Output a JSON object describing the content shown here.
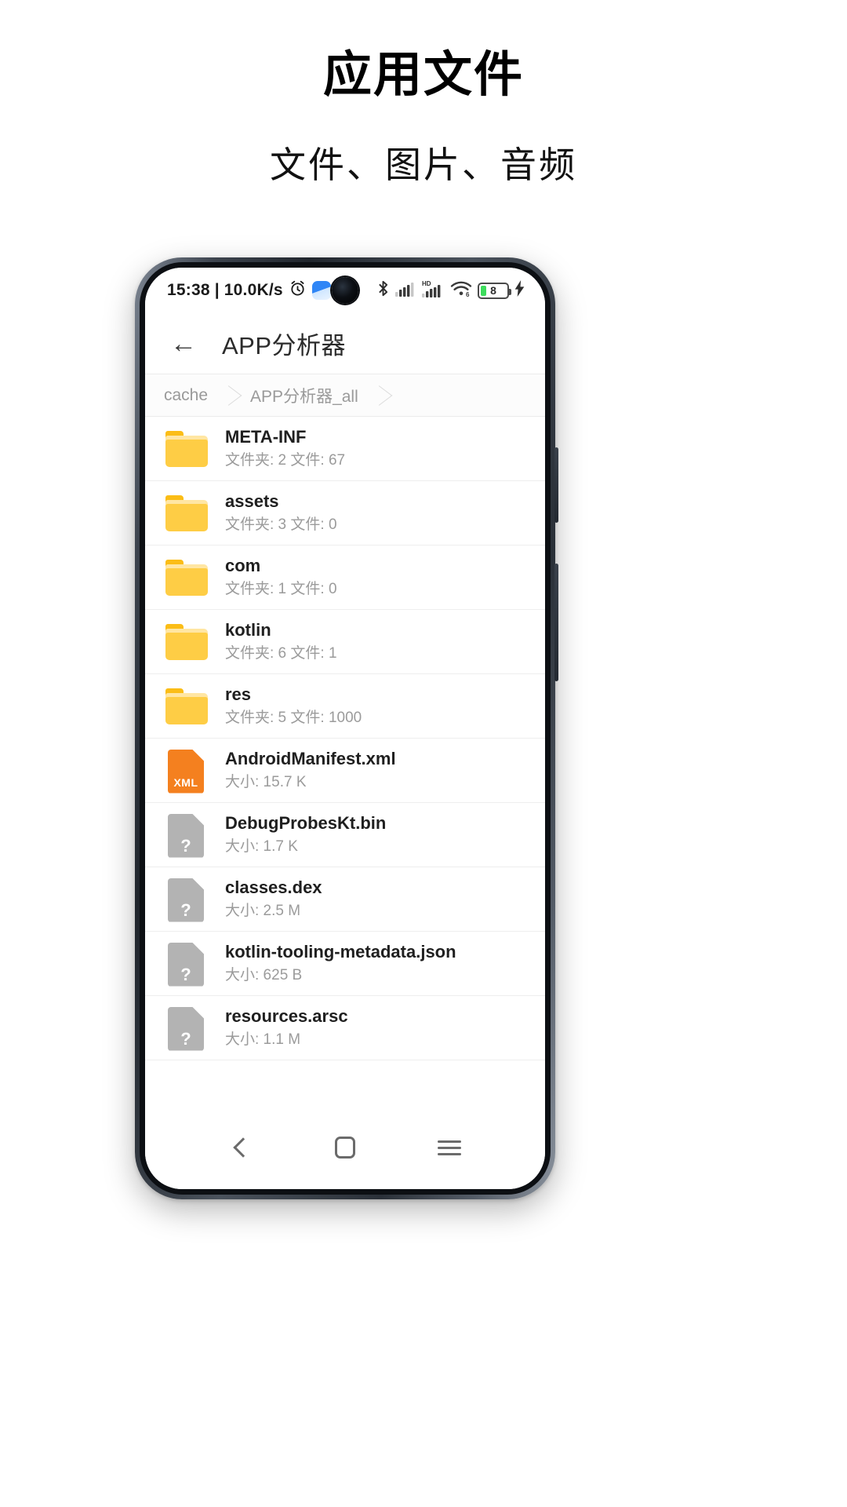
{
  "promo": {
    "title": "应用文件",
    "subtitle": "文件、图片、音频"
  },
  "phone": {
    "status_bar": {
      "time": "15:38",
      "divider": "|",
      "network_speed": "10.0K/s",
      "alarm_icon": "alarm-clock-icon",
      "app_badge_icon": "weather-app-icon",
      "bluetooth_icon": "bluetooth-icon",
      "signal_icon": "signal-bars-icon",
      "hd_label": "HD",
      "hd_signal_icon": "hd-signal-bars-icon",
      "wifi_icon": "wifi-icon",
      "wifi_generation": "6",
      "battery_level": "8",
      "charging_icon": "charging-bolt-icon"
    },
    "appbar": {
      "back_icon": "←",
      "title": "APP分析器"
    },
    "breadcrumb": {
      "items": [
        {
          "label": "cache"
        },
        {
          "label": "APP分析器_all"
        }
      ]
    },
    "files": [
      {
        "name": "META-INF",
        "meta": "文件夹: 2 文件: 67",
        "icon": "folder",
        "glyph": ""
      },
      {
        "name": "assets",
        "meta": "文件夹: 3 文件: 0",
        "icon": "folder",
        "glyph": ""
      },
      {
        "name": "com",
        "meta": "文件夹: 1 文件: 0",
        "icon": "folder",
        "glyph": ""
      },
      {
        "name": "kotlin",
        "meta": "文件夹: 6 文件: 1",
        "icon": "folder",
        "glyph": ""
      },
      {
        "name": "res",
        "meta": "文件夹: 5 文件: 1000",
        "icon": "folder",
        "glyph": ""
      },
      {
        "name": "AndroidManifest.xml",
        "meta": "大小: 15.7 K",
        "icon": "xml-doc",
        "glyph": "XML"
      },
      {
        "name": "DebugProbesKt.bin",
        "meta": "大小: 1.7 K",
        "icon": "unknown-doc",
        "glyph": "?"
      },
      {
        "name": "classes.dex",
        "meta": "大小: 2.5 M",
        "icon": "unknown-doc",
        "glyph": "?"
      },
      {
        "name": "kotlin-tooling-metadata.json",
        "meta": "大小: 625 B",
        "icon": "unknown-doc",
        "glyph": "?"
      },
      {
        "name": "resources.arsc",
        "meta": "大小: 1.1 M",
        "icon": "unknown-doc",
        "glyph": "?"
      }
    ],
    "navbar": {
      "back_label": "back",
      "home_label": "home",
      "recents_label": "recents"
    }
  },
  "colors": {
    "folder": "#fecd45",
    "folder_tab": "#fbbd16",
    "xml": "#f4801f",
    "unknown": "#b3b3b3",
    "battery_green": "#3ddc5c",
    "app_badge_blue": "#2f86f6"
  }
}
